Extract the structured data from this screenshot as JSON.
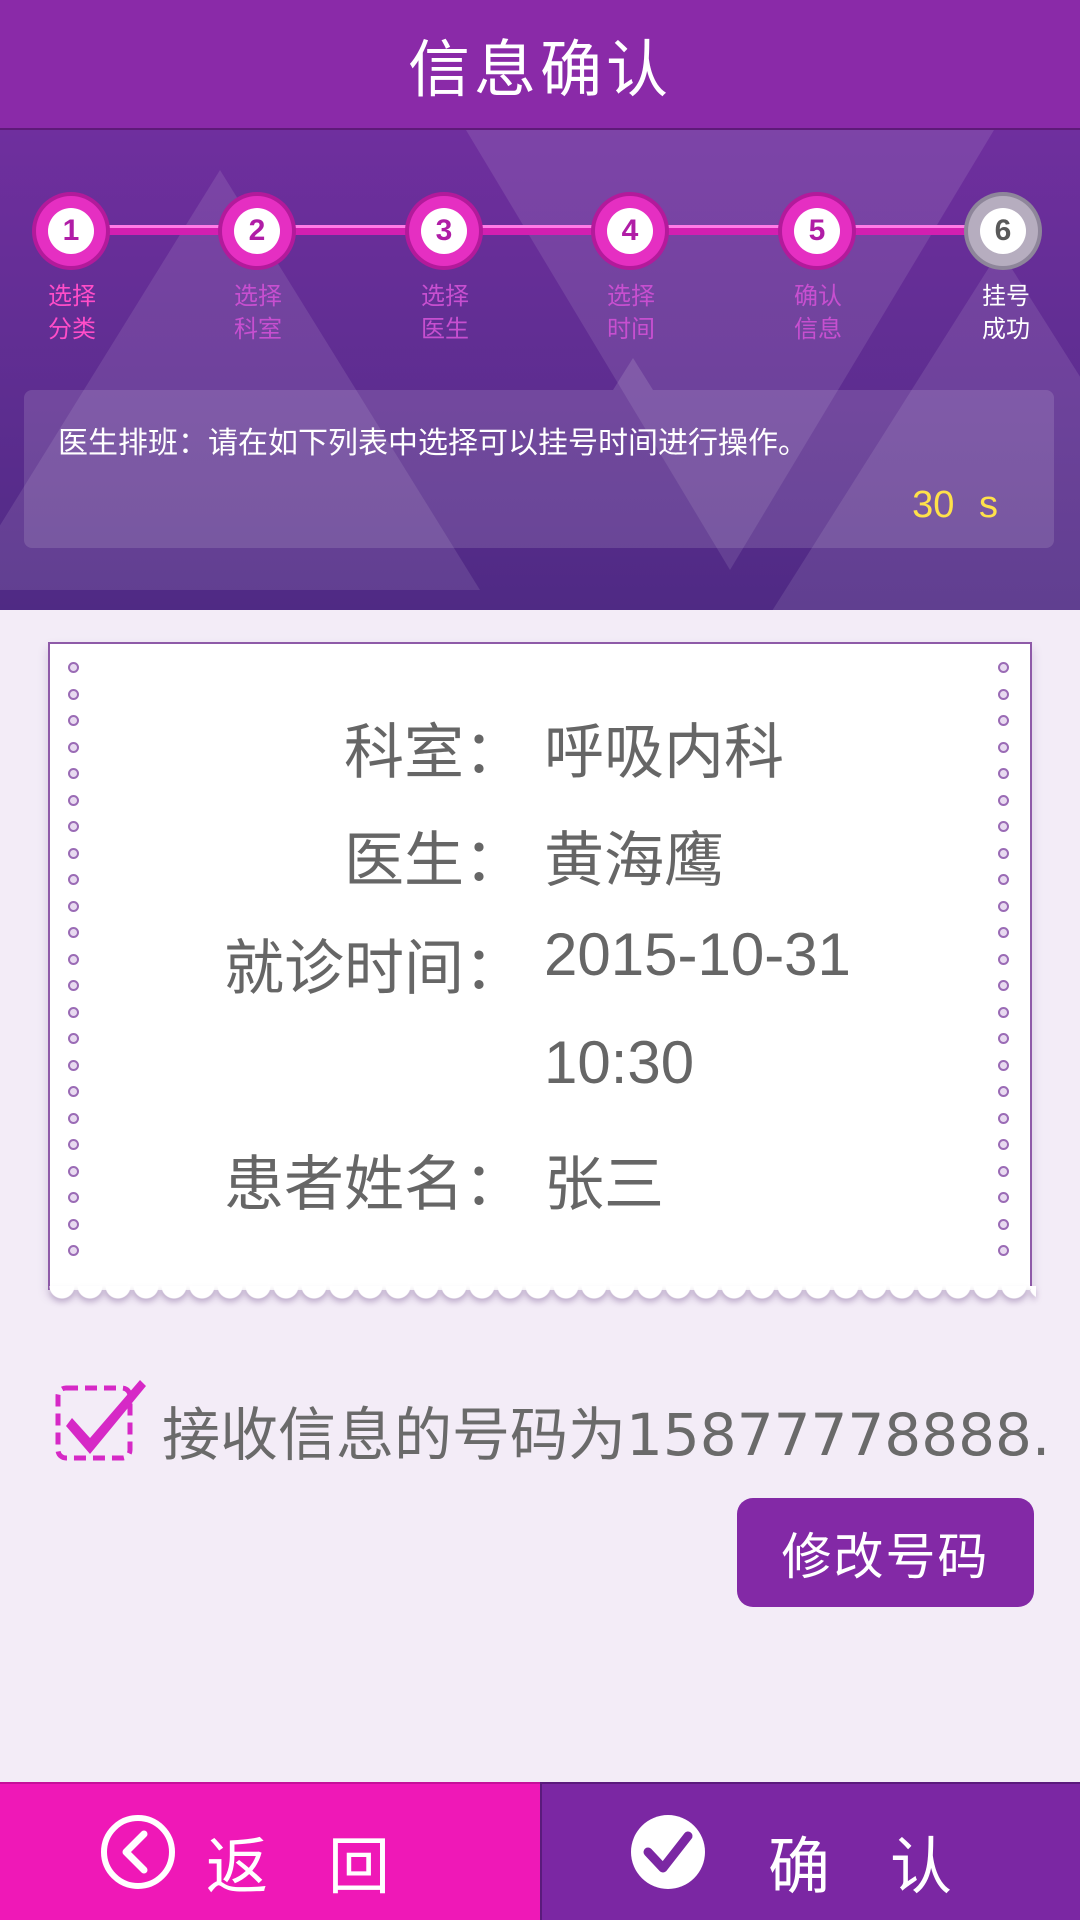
{
  "header": {
    "title": "信息确认"
  },
  "steps": [
    {
      "number": "1",
      "label_line1": "选择",
      "label_line2": "分类"
    },
    {
      "number": "2",
      "label_line1": "选择",
      "label_line2": "科室"
    },
    {
      "number": "3",
      "label_line1": "选择",
      "label_line2": "医生"
    },
    {
      "number": "4",
      "label_line1": "选择",
      "label_line2": "时间"
    },
    {
      "number": "5",
      "label_line1": "确认",
      "label_line2": "信息"
    },
    {
      "number": "6",
      "label_line1": "挂号",
      "label_line2": "成功"
    }
  ],
  "notice": {
    "text": "医生排班：请在如下列表中选择可以挂号时间进行操作。",
    "countdown": "30 s"
  },
  "ticket": {
    "department_label": "科室：",
    "department_value": "呼吸内科",
    "doctor_label": "医生：",
    "doctor_value": "黄海鹰",
    "time_label": "就诊时间：",
    "time_date": "2015-10-31",
    "time_clock": "10:30",
    "patient_label": "患者姓名：",
    "patient_value": "张三"
  },
  "sms": {
    "checked": true,
    "text": "接收信息的号码为15877778888."
  },
  "modify_button": "修改号码",
  "footer": {
    "back_label": "返回",
    "confirm_label": "确认"
  },
  "colors": {
    "title_bar": "#8a2aa8",
    "accent_pink": "#ef18b7",
    "accent_purple": "#7b27a3",
    "countdown": "#ffe14a"
  }
}
